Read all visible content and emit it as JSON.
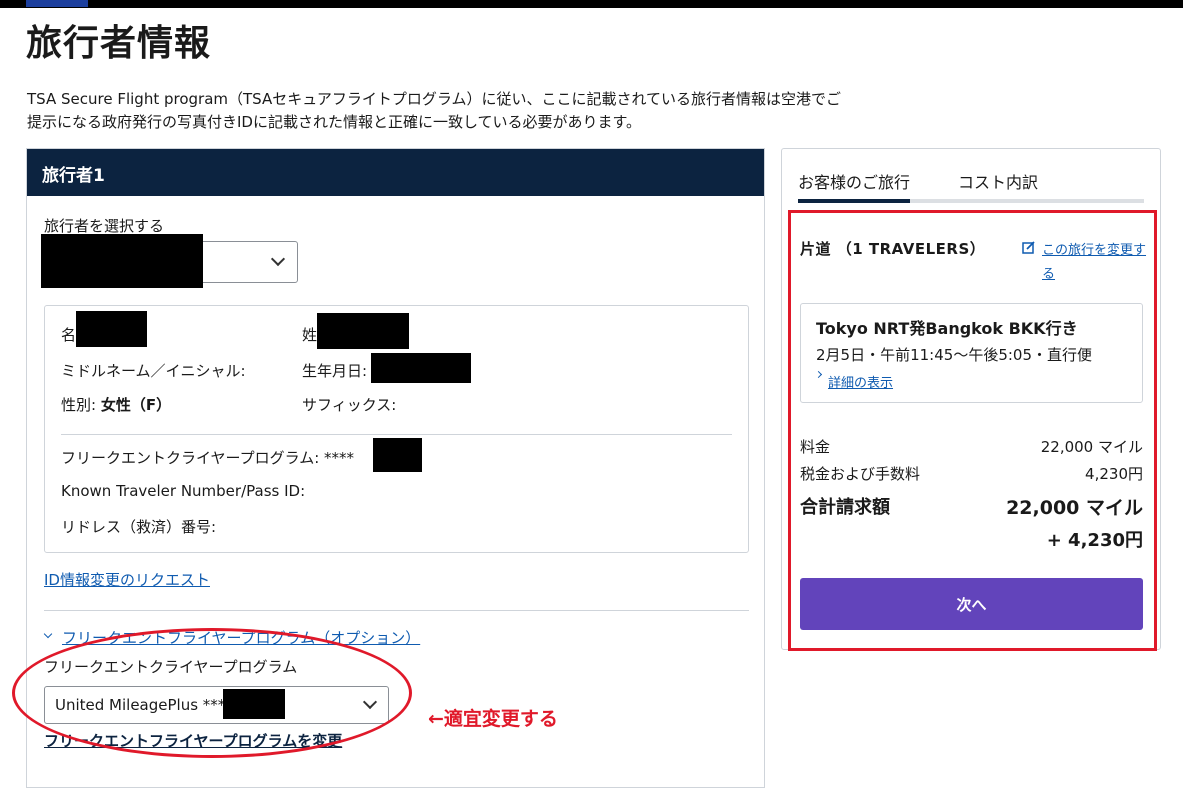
{
  "page": {
    "title": "旅行者情報",
    "intro_line1": "TSA Secure Flight program（TSAセキュアフライトプログラム）に従い、ここに記載されている旅行者情報は空港でご",
    "intro_line2": "提示になる政府発行の写真付きIDに記載された情報と正確に一致している必要があります。"
  },
  "traveler": {
    "header": "旅行者1",
    "select_label": "旅行者を選択する",
    "first_name_label": "名",
    "last_name_label": "姓",
    "middle_label": "ミドルネーム／イニシャル:",
    "dob_label": "生年月日:",
    "gender_label": "性別: ",
    "gender_value": "女性（F）",
    "suffix_label": "サフィックス:",
    "ff_program_label": "フリークエントクライヤープログラム: ****",
    "ktn_label": "Known Traveler Number/Pass ID:",
    "redress_label": "リドレス（救済）番号:",
    "id_change_link": "ID情報変更のリクエスト",
    "ff_section_link": "フリークエントフライヤープログラム（オプション）",
    "ff_select_label": "フリークエントクライヤープログラム",
    "ff_select_value": "United MileagePlus ***",
    "ff_change_link": "フリークエントフライヤープログラムを変更"
  },
  "annotation": {
    "text": "←適宜変更する"
  },
  "summary": {
    "tab_trip": "お客様のご旅行",
    "tab_cost": "コスト内訳",
    "trip_type": "片道 （1 TRAVELERS）",
    "change_trip_link_1": "この旅行を変更す",
    "change_trip_link_2": "る",
    "route": "Tokyo NRT発Bangkok BKK行き",
    "schedule": "2月5日・午前11:45〜午後5:05・直行便",
    "details_link": "詳細の表示",
    "fare_label": "料金",
    "fare_value": "22,000 マイル",
    "tax_label": "税金および手数料",
    "tax_value": "4,230円",
    "total_label": "合計請求額",
    "total_miles": "22,000 マイル",
    "total_yen": "+ 4,230円",
    "next_button": "次へ"
  }
}
